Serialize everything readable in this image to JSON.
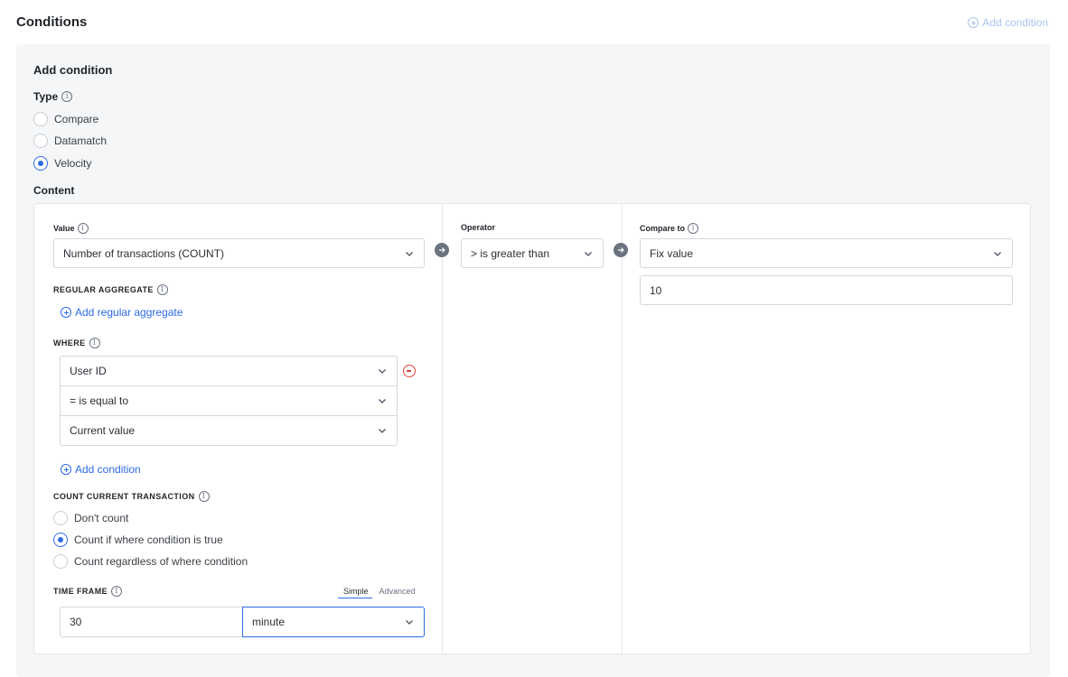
{
  "header": {
    "title": "Conditions",
    "add_condition_label": "Add condition"
  },
  "form": {
    "title": "Add condition",
    "type_label": "Type",
    "type_options": [
      "Compare",
      "Datamatch",
      "Velocity"
    ],
    "type_selected": "Velocity",
    "content_label": "Content"
  },
  "value_col": {
    "label": "Value",
    "selected": "Number of transactions (COUNT)",
    "regular_aggregate_label": "REGULAR AGGREGATE",
    "add_regular_aggregate": "Add regular aggregate",
    "where_label": "WHERE",
    "where_field": "User ID",
    "where_operator": "= is equal to",
    "where_value": "Current value",
    "add_condition": "Add condition",
    "count_current_label": "COUNT CURRENT TRANSACTION",
    "count_options": [
      "Don't count",
      "Count if where condition is true",
      "Count regardless of where condition"
    ],
    "count_selected": "Count if where condition is true",
    "time_frame_label": "TIME FRAME",
    "time_frame_tabs": [
      "Simple",
      "Advanced"
    ],
    "time_frame_active_tab": "Simple",
    "time_frame_amount": "30",
    "time_frame_unit": "minute"
  },
  "operator_col": {
    "label": "Operator",
    "selected": "> is greater than"
  },
  "compare_col": {
    "label": "Compare to",
    "selected": "Fix value",
    "value": "10"
  },
  "icons": {
    "info": "info-icon",
    "chevron": "chevron-down-icon",
    "arrow": "arrow-right-circle-icon",
    "add": "plus-circle-icon",
    "remove": "minus-circle-icon"
  },
  "colors": {
    "accent": "#2d6be4",
    "danger": "#e0453a",
    "panel_bg": "#f5f6f7",
    "faded_link": "#a9c4ef"
  }
}
